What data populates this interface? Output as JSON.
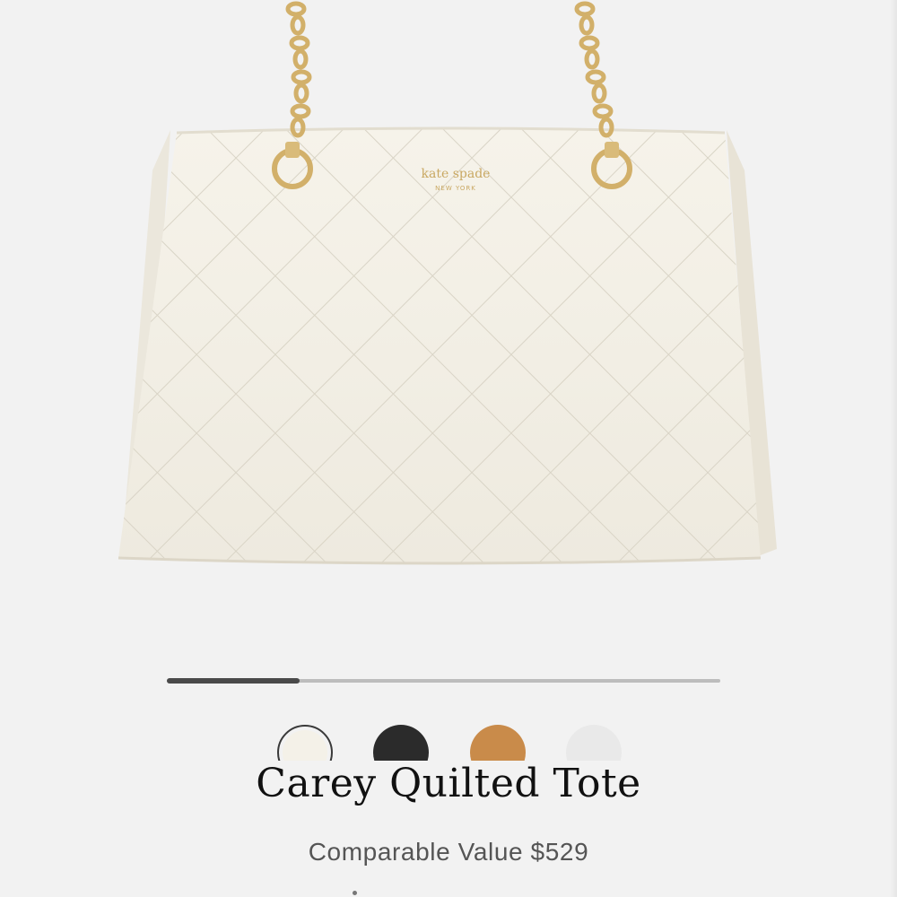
{
  "product": {
    "title": "Carey Quilted Tote",
    "price_label": "Comparable Value $529",
    "brand_mark": "kate spade",
    "brand_sub": "NEW YORK"
  },
  "carousel": {
    "progress_fraction": 0.24
  },
  "swatches": [
    {
      "name": "cream",
      "color": "#f4f1e8",
      "selected": true
    },
    {
      "name": "black",
      "color": "#2b2b2b",
      "selected": false
    },
    {
      "name": "tan",
      "color": "#c98b4a",
      "selected": false
    },
    {
      "name": "white",
      "color": "#e9e9e9",
      "selected": false
    }
  ],
  "colors": {
    "background": "#f2f2f2",
    "bag": "#f4f1e6",
    "hardware_gold": "#d2b06a"
  }
}
